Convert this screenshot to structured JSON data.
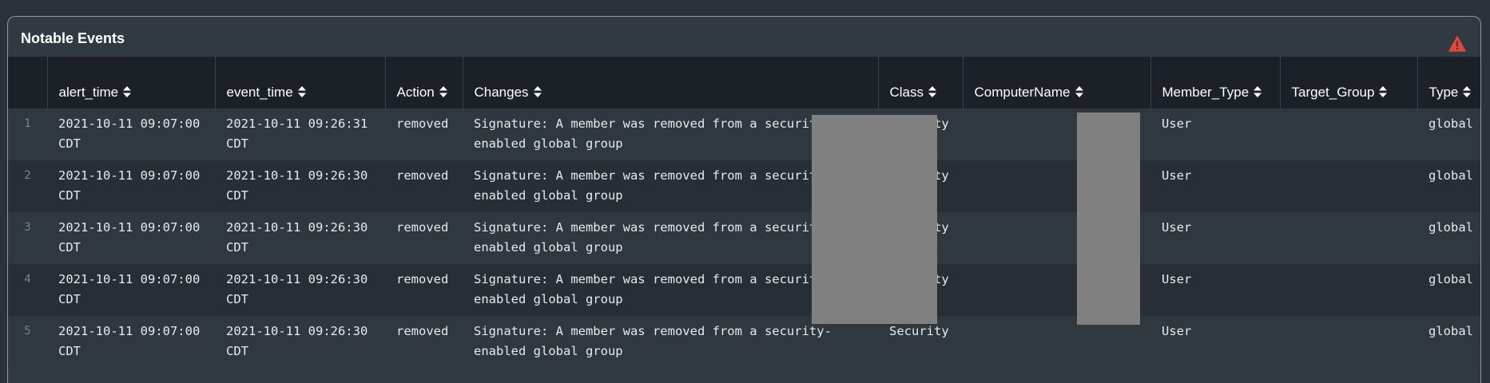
{
  "panel": {
    "title": "Notable Events",
    "alert_icon": "warning-triangle-icon",
    "alert_color": "#e0443a"
  },
  "table": {
    "columns": [
      {
        "key": "row",
        "label": ""
      },
      {
        "key": "alert_time",
        "label": "alert_time"
      },
      {
        "key": "event_time",
        "label": "event_time"
      },
      {
        "key": "Action",
        "label": "Action"
      },
      {
        "key": "Changes",
        "label": "Changes"
      },
      {
        "key": "Class",
        "label": "Class"
      },
      {
        "key": "ComputerName",
        "label": "ComputerName"
      },
      {
        "key": "Member_Type",
        "label": "Member_Type"
      },
      {
        "key": "Target_Group",
        "label": "Target_Group"
      },
      {
        "key": "Type",
        "label": "Type"
      }
    ],
    "rows": [
      {
        "row": "1",
        "alert_time": "2021-10-11 09:07:00 CDT",
        "event_time": "2021-10-11 09:26:31 CDT",
        "Action": "removed",
        "Changes": "Signature: A member was removed from a security-enabled global group",
        "Class": "Security",
        "ComputerName": "",
        "Member_Type": "User",
        "Target_Group": "",
        "Type": "global"
      },
      {
        "row": "2",
        "alert_time": "2021-10-11 09:07:00 CDT",
        "event_time": "2021-10-11 09:26:30 CDT",
        "Action": "removed",
        "Changes": "Signature: A member was removed from a security-enabled global group",
        "Class": "Security",
        "ComputerName": "",
        "Member_Type": "User",
        "Target_Group": "",
        "Type": "global"
      },
      {
        "row": "3",
        "alert_time": "2021-10-11 09:07:00 CDT",
        "event_time": "2021-10-11 09:26:30 CDT",
        "Action": "removed",
        "Changes": "Signature: A member was removed from a security-enabled global group",
        "Class": "Security",
        "ComputerName": "",
        "Member_Type": "User",
        "Target_Group": "",
        "Type": "global"
      },
      {
        "row": "4",
        "alert_time": "2021-10-11 09:07:00 CDT",
        "event_time": "2021-10-11 09:26:30 CDT",
        "Action": "removed",
        "Changes": "Signature: A member was removed from a security-enabled global group",
        "Class": "Security",
        "ComputerName": "",
        "Member_Type": "User",
        "Target_Group": "",
        "Type": "global"
      },
      {
        "row": "5",
        "alert_time": "2021-10-11 09:07:00 CDT",
        "event_time": "2021-10-11 09:26:30 CDT",
        "Action": "removed",
        "Changes": "Signature: A member was removed from a security-enabled global group",
        "Class": "Security",
        "ComputerName": "",
        "Member_Type": "User",
        "Target_Group": "",
        "Type": "global"
      }
    ]
  }
}
